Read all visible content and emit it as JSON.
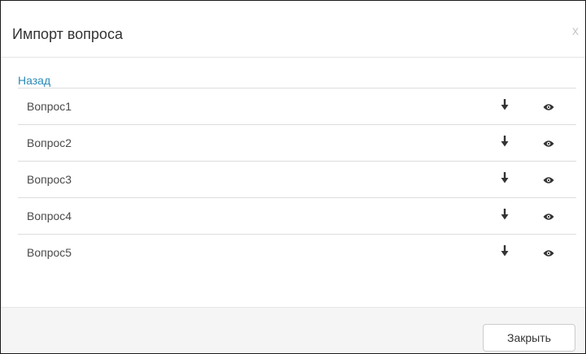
{
  "dialog": {
    "title": "Импорт вопроса",
    "close_x": "x"
  },
  "body": {
    "back_link": "Назад",
    "items": [
      {
        "label": "Вопрос1",
        "actions": [
          "download-arrow-icon",
          "eye-icon"
        ]
      },
      {
        "label": "Вопрос2",
        "actions": [
          "download-arrow-icon",
          "eye-icon"
        ]
      },
      {
        "label": "Вопрос3",
        "actions": [
          "download-arrow-icon",
          "eye-icon"
        ]
      },
      {
        "label": "Вопрос4",
        "actions": [
          "download-arrow-icon",
          "eye-icon"
        ]
      },
      {
        "label": "Вопрос5",
        "actions": [
          "download-arrow-icon",
          "eye-icon"
        ]
      }
    ]
  },
  "footer": {
    "close_label": "Закрыть"
  },
  "colors": {
    "link": "#2a8ab8",
    "footer_bg": "#f5f5f5",
    "divider": "#dddddd"
  }
}
